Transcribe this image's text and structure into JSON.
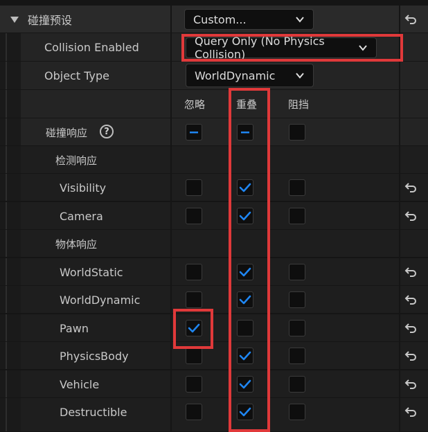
{
  "section": {
    "title": "碰撞预设",
    "preset_value": "Custom..."
  },
  "collision_enabled": {
    "label": "Collision Enabled",
    "value": "Query Only (No Physics Collision)"
  },
  "object_type": {
    "label": "Object Type",
    "value": "WorldDynamic"
  },
  "columns": {
    "ignore": "忽略",
    "overlap": "重叠",
    "block": "阻挡"
  },
  "collision_response": {
    "label": "碰撞响应",
    "help_glyph": "?"
  },
  "trace_responses": {
    "label": "检测响应"
  },
  "object_responses": {
    "label": "物体响应"
  },
  "channels": [
    {
      "name": "Visibility",
      "state": "overlap"
    },
    {
      "name": "Camera",
      "state": "overlap"
    },
    {
      "name": "WorldStatic",
      "state": "overlap"
    },
    {
      "name": "WorldDynamic",
      "state": "overlap"
    },
    {
      "name": "Pawn",
      "state": "ignore"
    },
    {
      "name": "PhysicsBody",
      "state": "overlap"
    },
    {
      "name": "Vehicle",
      "state": "overlap"
    },
    {
      "name": "Destructible",
      "state": "overlap"
    }
  ],
  "colors": {
    "check": "#1f86f2",
    "highlight": "#e0393a"
  },
  "icons": {
    "reset": "reset-arrow-icon",
    "expand": "triangle-down-icon",
    "chevron": "chevron-down-icon",
    "check": "checkmark-icon",
    "dash": "indeterminate-dash-icon"
  }
}
